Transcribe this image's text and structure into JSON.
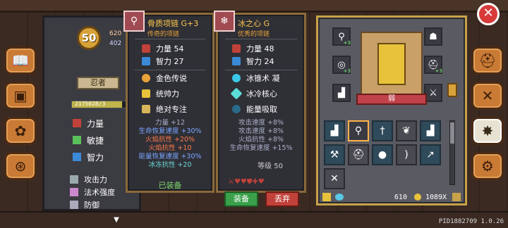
{
  "hud": {
    "level": "50",
    "hp_partial": "620",
    "mp_partial": "402",
    "hero_title_partial": "忍者",
    "xp_text": "2175028/3",
    "xp_fraction": 0.72,
    "attributes": [
      {
        "label": "力量",
        "icon": "fist-icon"
      },
      {
        "label": "敏捷",
        "icon": "feather-icon"
      },
      {
        "label": "智力",
        "icon": "book-icon"
      }
    ],
    "derived": [
      {
        "label": "攻击力",
        "icon": "sword-icon"
      },
      {
        "label": "法术强度",
        "icon": "wand-icon"
      },
      {
        "label": "防御",
        "icon": "shield-icon"
      }
    ]
  },
  "card_left": {
    "title": "骨质项链 G+3",
    "subtitle": "传奇的项链",
    "stats": [
      {
        "label": "力量",
        "value": "54"
      },
      {
        "label": "智力",
        "value": "27"
      }
    ],
    "traits": [
      "金色传说",
      "统帅力",
      "绝对专注"
    ],
    "bonuses": [
      {
        "text": "力量 +12",
        "kind": "gray"
      },
      {
        "text": "生命恢复速度 +30%",
        "kind": ""
      },
      {
        "text": "火焰抗性 +20%",
        "kind": "fire"
      },
      {
        "text": "火焰抗性 +10",
        "kind": "fire"
      },
      {
        "text": "能量恢复速度 +30%",
        "kind": ""
      },
      {
        "text": "冰冻抗性 +20",
        "kind": "ice"
      }
    ],
    "status": "已装备"
  },
  "card_right": {
    "title": "冰之心 G",
    "subtitle": "优秀的项链",
    "stats": [
      {
        "label": "力量",
        "value": "48"
      },
      {
        "label": "智力",
        "value": "24"
      }
    ],
    "traits": [
      "冰锥术 凝",
      "冰冷核心",
      "能量吸取"
    ],
    "bonuses": [
      {
        "text": "攻击速度 +8%",
        "kind": "gray"
      },
      {
        "text": "攻击速度 +8%",
        "kind": "gray"
      },
      {
        "text": "火焰抗性 +8%",
        "kind": "gray"
      },
      {
        "text": "生命恢复速度 +15%",
        "kind": "gray"
      }
    ],
    "grade_label": "等级 50",
    "equip_button": "装备",
    "drop_button": "丢弃"
  },
  "inventory": {
    "hero_name": "弱",
    "currency_left": "610",
    "currency_right": "1089X"
  },
  "version": "PID1882709 1.0.26",
  "colors": {
    "accent_gold": "#c8a24a",
    "equip_green": "#3aa04a",
    "drop_red": "#c0423a"
  }
}
